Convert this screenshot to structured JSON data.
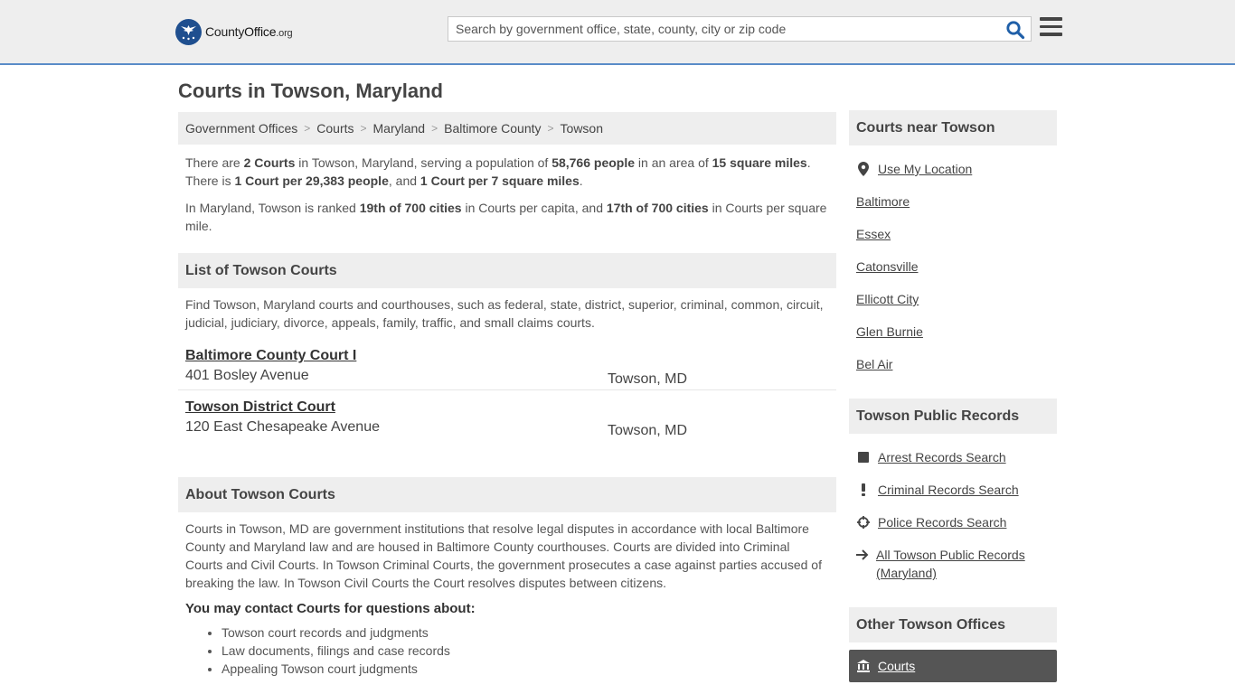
{
  "header": {
    "logo_text_a": "County",
    "logo_text_b": "Office",
    "logo_text_c": ".org",
    "search_placeholder": "Search by government office, state, county, city or zip code"
  },
  "page_title": "Courts in Towson, Maryland",
  "breadcrumb": [
    "Government Offices",
    "Courts",
    "Maryland",
    "Baltimore County",
    "Towson"
  ],
  "intro": {
    "p1": {
      "t1": "There are ",
      "b1": "2 Courts",
      "t2": " in Towson, Maryland, serving a population of ",
      "b2": "58,766 people",
      "t3": " in an area of ",
      "b3": "15 square miles",
      "t4": ". There is ",
      "b4": "1 Court per 29,383 people",
      "t5": ", and ",
      "b5": "1 Court per 7 square miles",
      "t6": "."
    },
    "p2": {
      "t1": "In Maryland, Towson is ranked ",
      "b1": "19th of 700 cities",
      "t2": " in Courts per capita, and ",
      "b2": "17th of 700 cities",
      "t3": " in Courts per square mile."
    }
  },
  "list_section": {
    "heading": "List of Towson Courts",
    "description": "Find Towson, Maryland courts and courthouses, such as federal, state, district, superior, criminal, common, circuit, judicial, judiciary, divorce, appeals, family, traffic, and small claims courts.",
    "courts": [
      {
        "name": "Baltimore County Court I",
        "address": "401 Bosley Avenue",
        "city": "Towson, MD"
      },
      {
        "name": "Towson District Court",
        "address": "120 East Chesapeake Avenue",
        "city": "Towson, MD"
      }
    ]
  },
  "about_section": {
    "heading": "About Towson Courts",
    "body": "Courts in Towson, MD are government institutions that resolve legal disputes in accordance with local Baltimore County and Maryland law and are housed in Baltimore County courthouses. Courts are divided into Criminal Courts and Civil Courts. In Towson Criminal Courts, the government prosecutes a case against parties accused of breaking the law. In Towson Civil Courts the Court resolves disputes between citizens.",
    "contact_heading": "You may contact Courts for questions about:",
    "items": [
      "Towson court records and judgments",
      "Law documents, filings and case records",
      "Appealing Towson court judgments"
    ]
  },
  "sidebar": {
    "near": {
      "heading": "Courts near Towson",
      "use_location": "Use My Location",
      "location_icon": "map-pin-icon",
      "cities": [
        "Baltimore",
        "Essex",
        "Catonsville",
        "Ellicott City",
        "Glen Burnie",
        "Bel Air"
      ]
    },
    "records": {
      "heading": "Towson Public Records",
      "links": [
        {
          "label": "Arrest Records Search",
          "icon": "square-icon"
        },
        {
          "label": "Criminal Records Search",
          "icon": "exclamation-icon"
        },
        {
          "label": "Police Records Search",
          "icon": "crosshair-icon"
        },
        {
          "label": "All Towson Public Records (Maryland)",
          "icon": "arrow-right-icon"
        }
      ]
    },
    "other": {
      "heading": "Other Towson Offices",
      "active_label": "Courts",
      "active_icon": "courthouse-icon"
    }
  },
  "colors": {
    "header_bg": "#eeeeee",
    "header_border": "#5a8cc8",
    "search_icon": "#1f5fa8",
    "active_bg": "#555555"
  }
}
